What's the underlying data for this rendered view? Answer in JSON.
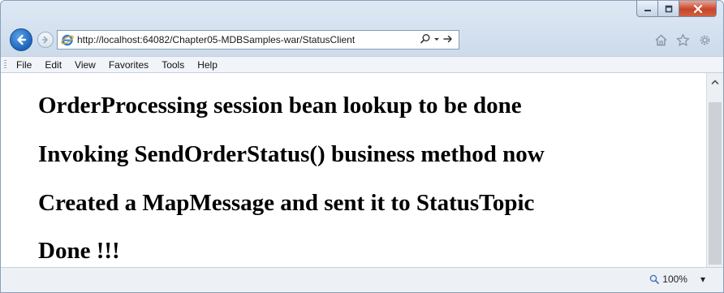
{
  "window": {
    "caption_buttons": [
      "minimize-icon",
      "maximize-icon",
      "close-icon"
    ]
  },
  "address_bar": {
    "url": "http://localhost:64082/Chapter05-MDBSamples-war/StatusClient",
    "search_glyph": "⌕",
    "dropdown_glyph": "▾",
    "go_glyph": "→"
  },
  "toolbar_icons": [
    "home-icon",
    "favorites-star-icon",
    "settings-gear-icon"
  ],
  "menu": {
    "items": [
      "File",
      "Edit",
      "View",
      "Favorites",
      "Tools",
      "Help"
    ]
  },
  "content": {
    "lines": [
      "OrderProcessing session bean lookup to be done",
      "Invoking SendOrderStatus() business method now",
      "Created a MapMessage and sent it to StatusTopic",
      "Done !!!"
    ]
  },
  "status_bar": {
    "zoom": "100%",
    "zoom_dropdown": "▾"
  },
  "colors": {
    "frame": "#cddbeb",
    "back_button": "#1d64b8",
    "close_button": "#c7462b"
  }
}
